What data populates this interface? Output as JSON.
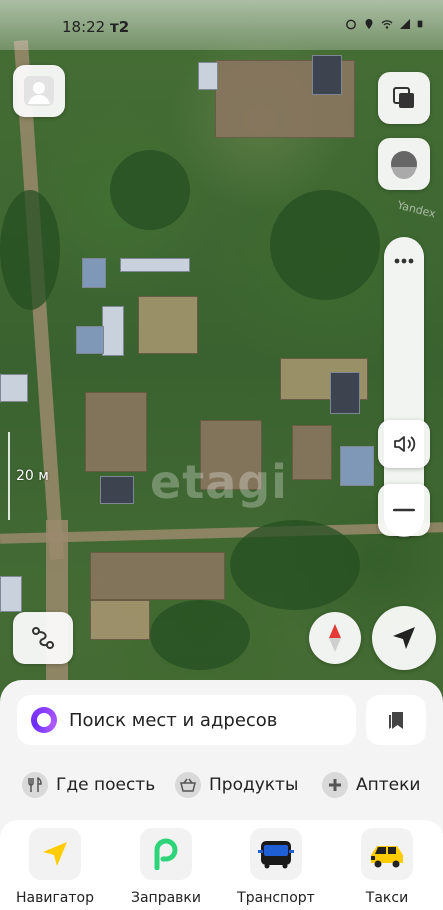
{
  "status_bar": {
    "time": "18:22",
    "indicator": "т2",
    "icons": [
      "alarm-icon",
      "location-icon",
      "wifi-icon",
      "signal-icon",
      "battery-icon"
    ]
  },
  "map": {
    "watermark": "etagi",
    "provider_mark": "Yandex",
    "scale_label": "20 м"
  },
  "controls": {
    "avatar": "user-avatar-icon",
    "layers": "layers-icon",
    "orientation": "orientation-icon",
    "zoom_in": "zoom-in-icon",
    "sound": "sound-icon",
    "zoom_out": "minus-icon",
    "route": "route-icon",
    "compass": "compass-icon",
    "locate": "locate-arrow-icon"
  },
  "sheet": {
    "search_placeholder": "Поиск мест и адресов",
    "chips": [
      {
        "label": "Где поесть",
        "icon": "fork-knife-icon"
      },
      {
        "label": "Продукты",
        "icon": "basket-icon"
      },
      {
        "label": "Аптеки",
        "icon": "pharmacy-plus-icon"
      }
    ],
    "apps": [
      {
        "label": "Навигатор",
        "icon": "navigator-icon"
      },
      {
        "label": "Заправки",
        "icon": "fuel-icon"
      },
      {
        "label": "Транспорт",
        "icon": "bus-icon"
      },
      {
        "label": "Такси",
        "icon": "taxi-icon"
      }
    ]
  },
  "colors": {
    "accent_purple": "#8b3dff",
    "navigator_yellow": "#ffcc00",
    "fuel_green": "#2ed47a",
    "transit_blue": "#1f5fd6",
    "compass_red": "#e53935"
  }
}
